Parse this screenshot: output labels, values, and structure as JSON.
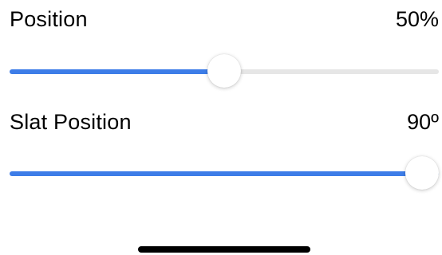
{
  "position": {
    "label": "Position",
    "value_text": "50%",
    "value": 0.5
  },
  "slat_position": {
    "label": "Slat Position",
    "value_text": "90º",
    "value": 1.0
  },
  "colors": {
    "accent": "#3d7de8",
    "track": "#e6e6e6",
    "text": "#000000"
  }
}
